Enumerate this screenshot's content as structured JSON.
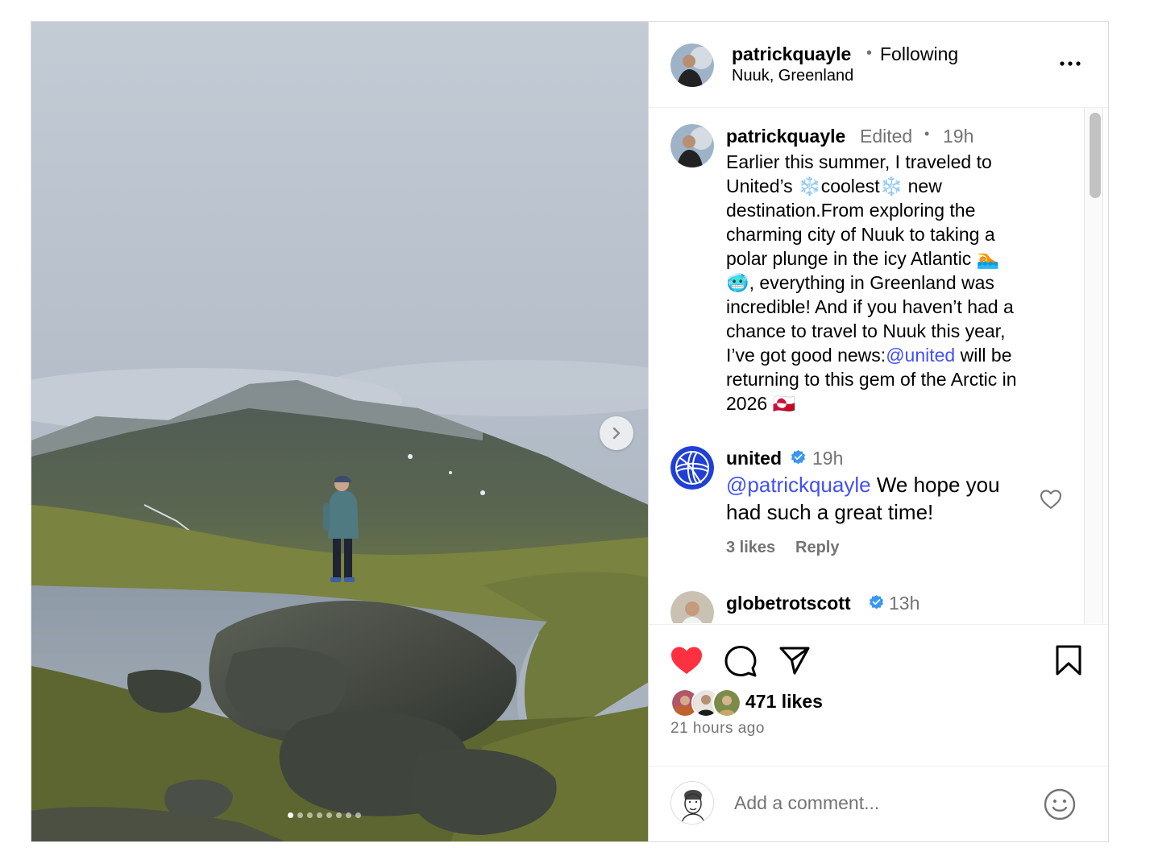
{
  "post": {
    "author": "patrickquayle",
    "separator": "•",
    "follow_status": "Following",
    "location": "Nuuk, Greenland",
    "more_icon": "more-horizontal-icon",
    "image_count": 8,
    "active_image_index": 0
  },
  "caption": {
    "user": "patrickquayle",
    "edited": "Edited",
    "separator": "•",
    "time": "19h",
    "line1": "Earlier this summer, I traveled to",
    "line2a": "United’s ",
    "line2b": "❄️coolest❄️",
    "line2c": " new",
    "line3": "destination.From exploring the",
    "line4": "charming city of Nuuk to taking a",
    "line5": "polar plunge in the icy Atlantic 🏊",
    "line6": "🥶, everything in Greenland was",
    "line7": "incredible! And if you haven’t had a",
    "line8": "chance to travel to Nuuk this year,",
    "line9a": "I’ve got good news:",
    "line9b": "@united",
    "line9c": " will be",
    "line10": "returning to this gem of the Arctic in",
    "line11": "2026 🇬🇱"
  },
  "comments": [
    {
      "user": "united",
      "verified": true,
      "time": "19h",
      "mention": "@patrickquayle",
      "text": " We hope you had such a great time!",
      "likes": "3 likes",
      "reply": "Reply"
    },
    {
      "user": "globetrotscott",
      "verified": true,
      "time": "13h"
    }
  ],
  "actions": {
    "liked": true,
    "like_color": "#ff3040",
    "likes": "471 likes",
    "time_ago": "21 hours ago"
  },
  "add_comment": {
    "placeholder": "Add a comment..."
  },
  "colors": {
    "mention": "#4150f7",
    "verified": "#3897f0",
    "muted": "#737373"
  }
}
